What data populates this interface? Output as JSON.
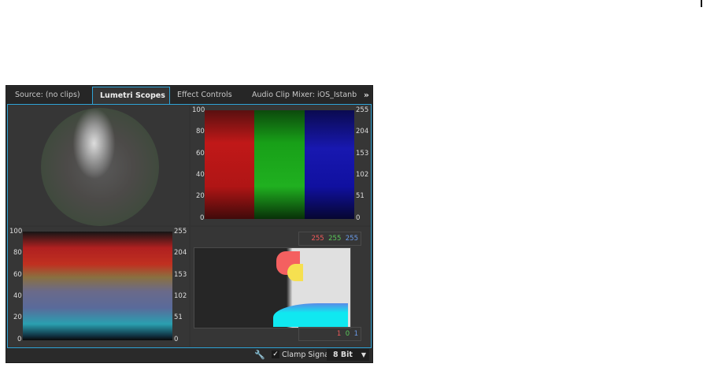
{
  "tabs": [
    {
      "label": "Source: (no clips)"
    },
    {
      "label": "Lumetri Scopes",
      "menu_icon": "≡",
      "active": true
    },
    {
      "label": "Effect Controls"
    },
    {
      "label": "Audio Clip Mixer: iOS_Istanb"
    }
  ],
  "overflow_icon": "»",
  "parade": {
    "left_ticks": [
      "100",
      "80",
      "60",
      "40",
      "20",
      "0"
    ],
    "right_ticks": [
      "255",
      "204",
      "153",
      "102",
      "51",
      "0"
    ]
  },
  "waveform": {
    "left_ticks": [
      "100",
      "80",
      "60",
      "40",
      "20",
      "0"
    ],
    "right_ticks": [
      "255",
      "204",
      "153",
      "102",
      "51",
      "0"
    ]
  },
  "histogram": {
    "top": {
      "r": "255",
      "g": "255",
      "b": "255"
    },
    "bottom": {
      "r": "1",
      "g": "0",
      "b": "1"
    }
  },
  "bottom_bar": {
    "wrench_icon": "🔧",
    "clamp_checked": "✓",
    "clamp_label": "Clamp Signal",
    "bit_depth": "8 Bit",
    "caret": "▼"
  },
  "colors": {
    "accent": "#2fa3d6",
    "red": "#f05a5a",
    "green": "#5ac85a",
    "blue": "#6a9ae8"
  }
}
